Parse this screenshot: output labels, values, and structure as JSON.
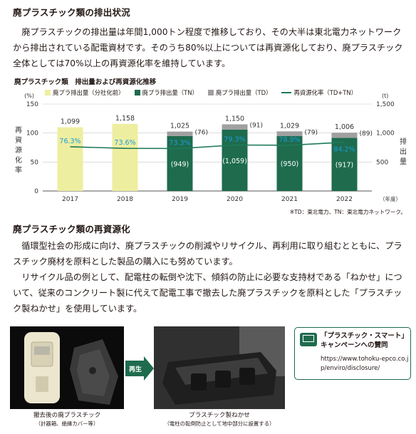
{
  "section1": {
    "heading": "廃プラスチック類の排出状況",
    "paragraph": "廃プラスチックの排出量は年間1,000トン程度で推移しており、その大半は東北電力ネットワークから排出されている配電資材です。そのうち80%以上については再資源化しており、廃プラスチック全体としては70%以上の再資源化率を維持しています。"
  },
  "chart": {
    "title": "廃プラスチック類　排出量および再資源化推移",
    "left_unit": "(%)",
    "right_unit": "(t)",
    "left_axis_label": "再資源化率",
    "right_axis_label": "排出量",
    "x_unit": "（年度）",
    "left_ticks": [
      "150",
      "100",
      "50",
      "0"
    ],
    "right_ticks": [
      "1,500",
      "1,000",
      "500"
    ],
    "note": "※TD：東北電力、TN：東北電力ネットワーク。",
    "legend": {
      "yellow": "廃プラ排出量（分社化前）",
      "green": "廃プラ排出量（TN）",
      "gray": "廃プラ排出量（TD）",
      "line": "再資源化率（TD+TN）"
    },
    "colors": {
      "yellow": "#eeeea0",
      "green": "#1e6b4e",
      "gray": "#a0a0a0",
      "line": "#1e7a5a",
      "rate_label": "#1a9fd8"
    }
  },
  "chart_data": {
    "type": "bar",
    "title": "廃プラスチック類　排出量および再資源化推移",
    "categories": [
      "2017",
      "2018",
      "2019",
      "2020",
      "2021",
      "2022"
    ],
    "series": [
      {
        "name": "廃プラ排出量（分社化前）",
        "values": [
          1099,
          1158,
          null,
          null,
          null,
          null
        ]
      },
      {
        "name": "廃プラ排出量（TN）",
        "values": [
          null,
          null,
          949,
          1059,
          950,
          917
        ]
      },
      {
        "name": "廃プラ排出量（TD）",
        "values": [
          null,
          null,
          76,
          91,
          79,
          89
        ]
      },
      {
        "name": "再資源化率（TD+TN）",
        "type": "line",
        "values": [
          76.3,
          73.6,
          73.3,
          79.3,
          78.9,
          84.2
        ]
      }
    ],
    "totals": [
      "1,099",
      "1,158",
      "1,025",
      "1,150",
      "1,029",
      "1,006"
    ],
    "tn_labels": [
      "",
      "",
      "(949)",
      "(1,059)",
      "(950)",
      "(917)"
    ],
    "td_labels": [
      "",
      "",
      "(76)",
      "(91)",
      "(79)",
      "(89)"
    ],
    "rate_labels": [
      "76.3%",
      "73.6%",
      "73.3%",
      "79.3%",
      "78.9%",
      "84.2%"
    ],
    "ylim_left": [
      0,
      150
    ],
    "ylim_right": [
      0,
      1500
    ]
  },
  "section2": {
    "heading": "廃プラスチック類の再資源化",
    "paragraph1": "循環型社会の形成に向け、廃プラスチックの削減やリサイクル、再利用に取り組むとともに、プラスチック廃材を原料とした製品の購入にも努めています。",
    "paragraph2": "リサイクル品の例として、配電柱の転倒や沈下、傾斜の防止に必要な支持材である「ねかせ」について、従来のコンクリート製に代えて配電工事で撤去した廃プラスチックを原料とした「プラスチック製ねかせ」を使用しています。"
  },
  "photos": {
    "left_caption": "撤去後の廃プラスチック",
    "left_sub": "（計器箱、絶縁カバー等）",
    "arrow_label": "再生",
    "right_caption": "プラスチック製ねかせ",
    "right_sub": "（電柱の転倒防止として地中部分に設置する）"
  },
  "campaign": {
    "title": "「プラスチック・スマート」キャンペーンへの賛同",
    "url": "https://www.tohoku-epco.co.jp/enviro/disclosure/"
  }
}
